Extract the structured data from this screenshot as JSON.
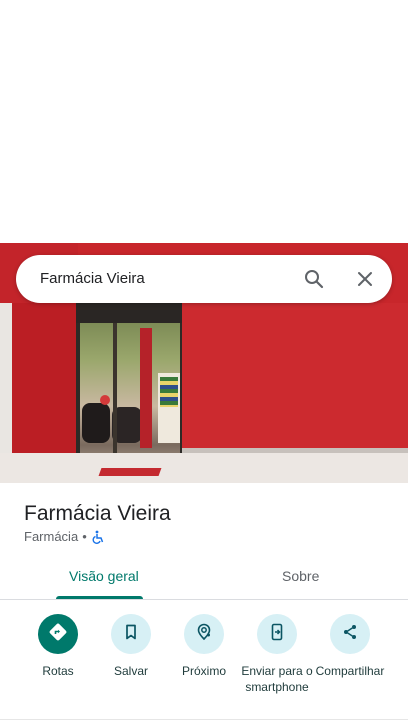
{
  "search": {
    "query": "Farmácia Vieira"
  },
  "place": {
    "name": "Farmácia Vieira",
    "category": "Farmácia",
    "separator": "•"
  },
  "tabs": [
    {
      "label": "Visão geral",
      "active": true
    },
    {
      "label": "Sobre",
      "active": false
    }
  ],
  "actions": [
    {
      "label": "Rotas",
      "icon": "directions-icon"
    },
    {
      "label": "Salvar",
      "icon": "bookmark-icon"
    },
    {
      "label": "Próximo",
      "icon": "nearby-icon"
    },
    {
      "label": "Enviar para o smartphone",
      "icon": "send-to-phone-icon"
    },
    {
      "label": "Compartilhar",
      "icon": "share-icon"
    }
  ],
  "colors": {
    "accent": "#00796b",
    "action_bg": "#d7f0f5",
    "text_primary": "#202124",
    "text_secondary": "#5f6368"
  }
}
